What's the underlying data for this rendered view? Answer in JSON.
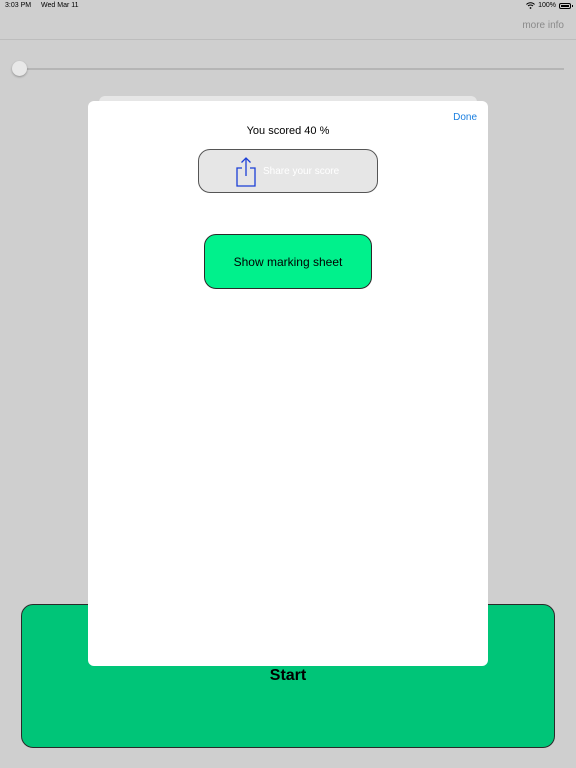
{
  "status_bar": {
    "time": "3:03 PM",
    "date": "Wed Mar 11",
    "battery": "100%"
  },
  "nav": {
    "more_info": "more info"
  },
  "slider": {
    "value": 0
  },
  "modal": {
    "done_label": "Done",
    "score_text": "You scored 40 %",
    "share_label": "Share your score",
    "marking_label": "Show marking sheet"
  },
  "start": {
    "label": "Start"
  },
  "colors": {
    "start_green": "#00c578",
    "marking_green": "#00f18c",
    "done_blue": "#1a7fe0"
  }
}
